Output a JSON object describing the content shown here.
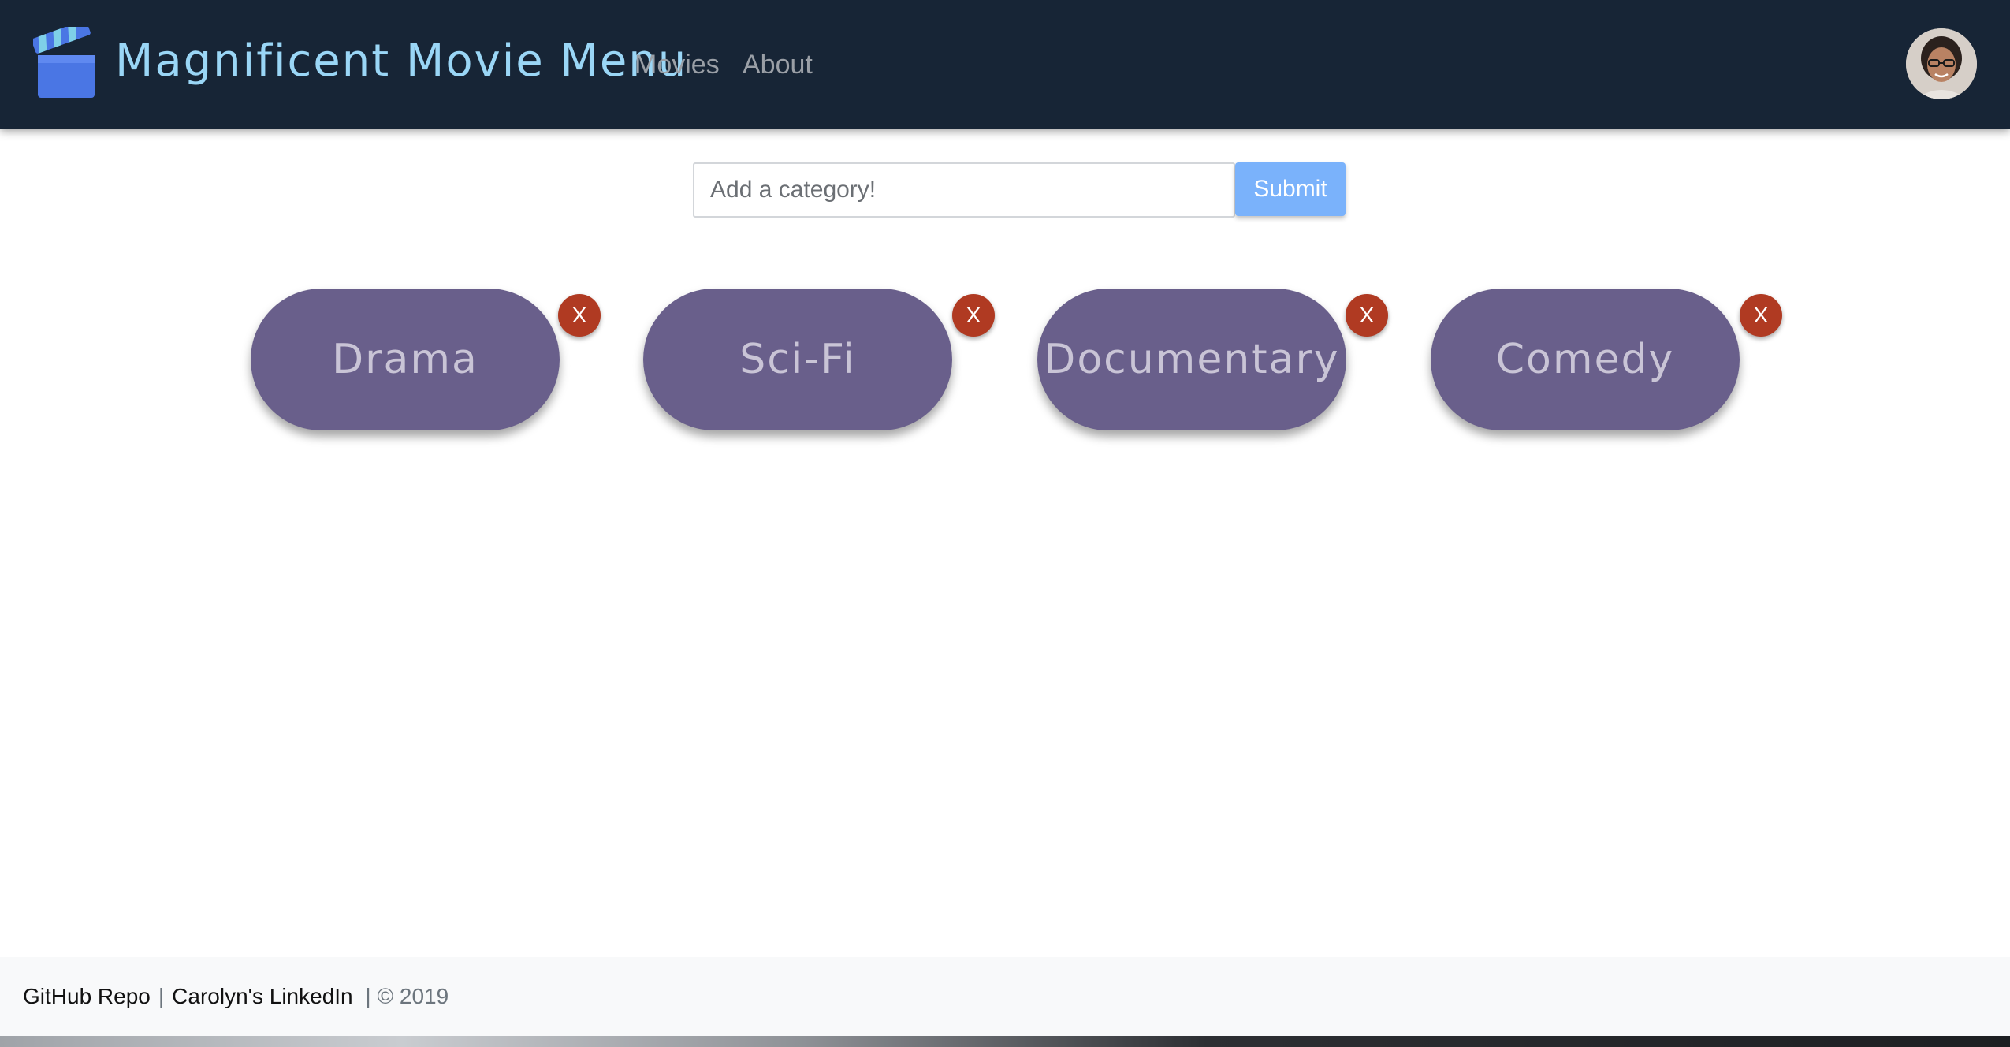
{
  "navbar": {
    "brand_title": "Magnificent Movie Menu",
    "brand_icon": "clapperboard-icon",
    "links": [
      {
        "label": "Movies"
      },
      {
        "label": "About"
      }
    ],
    "avatar_icon": "user-avatar"
  },
  "form": {
    "placeholder": "Add a category!",
    "value": "",
    "submit_label": "Submit"
  },
  "categories": [
    {
      "label": "Drama",
      "delete_label": "X"
    },
    {
      "label": "Sci-Fi",
      "delete_label": "X"
    },
    {
      "label": "Documentary",
      "delete_label": "X"
    },
    {
      "label": "Comedy",
      "delete_label": "X"
    }
  ],
  "footer": {
    "github_label": "GitHub Repo",
    "separator": "|",
    "linkedin_label": "Carolyn's LinkedIn",
    "copyright": "| © 2019"
  },
  "colors": {
    "navbar_bg": "#172536",
    "brand_text": "#9ad6f6",
    "pill_bg": "#695f8b",
    "pill_text": "#c9c4d6",
    "delete_bg": "#b03a22",
    "submit_bg": "#7ab2fb",
    "footer_bg": "#f8f9fa"
  }
}
